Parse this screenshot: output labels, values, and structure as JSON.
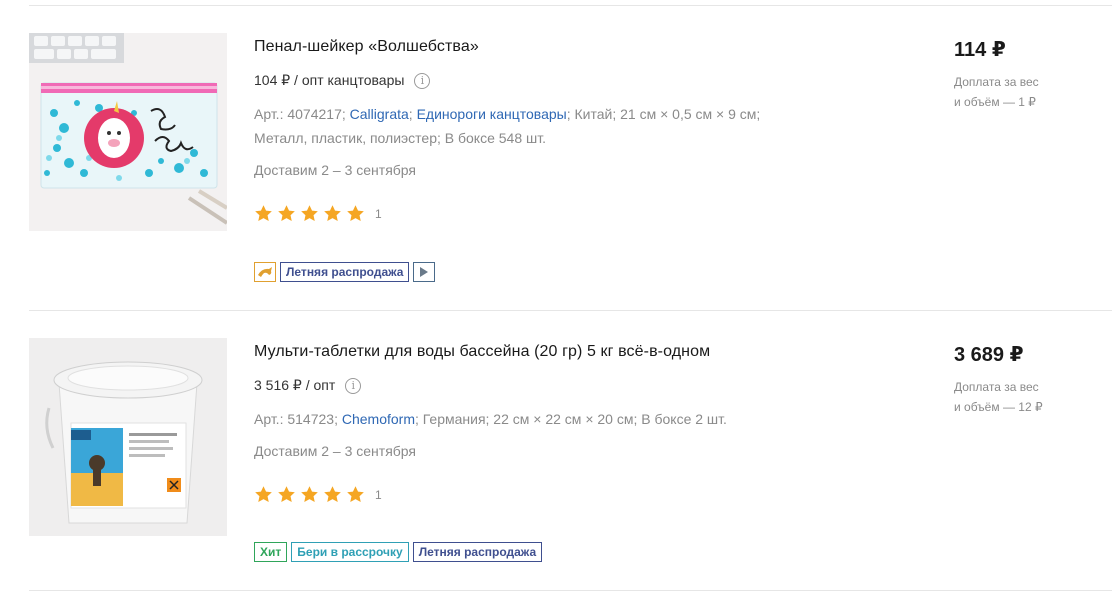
{
  "products": [
    {
      "title": "Пенал-шейкер «Волшебства»",
      "wholesale": "104 ₽ / опт канцтовары",
      "art_prefix": "Арт.: 4074217;",
      "brand": "Calligrata",
      "sep1": ";",
      "category": "Единороги канцтовары",
      "details_line1": "; Китай; 21 см × 0,5 см × 9 см;",
      "details_line2": "Металл, пластик, полиэстер; В боксе 548 шт.",
      "delivery": "Доставим 2 – 3 сентября",
      "stars": 5,
      "rating_count": "1",
      "badges": {
        "dolphin_icon": "dolphin-icon",
        "sale": "Летняя распродажа",
        "play_icon": "play-icon"
      },
      "price": "114 ₽",
      "extra_line1": "Доплата за вес",
      "extra_line2": "и объём — 1 ₽"
    },
    {
      "title": "Мульти-таблетки для воды бассейна (20 гр) 5 кг всё-в-одном",
      "wholesale": "3 516 ₽ / опт",
      "art_prefix": "Арт.: 514723;",
      "brand": "Chemoform",
      "details_line1": "; Германия; 22 см × 22 см × 20 см; В боксе 2 шт.",
      "delivery": "Доставим 2 – 3 сентября",
      "stars": 5,
      "rating_count": "1",
      "badges": {
        "hit": "Хит",
        "credit": "Бери в рассрочку",
        "sale": "Летняя распродажа"
      },
      "price": "3 689 ₽",
      "extra_line1": "Доплата за вес",
      "extra_line2": "и объём — 12 ₽"
    }
  ],
  "colors": {
    "link": "#2f68b4",
    "star": "#f5a623",
    "badge_sale": "#3f4f8f",
    "badge_hit": "#2fa55a",
    "badge_credit": "#2fa0b5"
  },
  "icons": {
    "info": "info-icon",
    "star": "star-icon"
  }
}
